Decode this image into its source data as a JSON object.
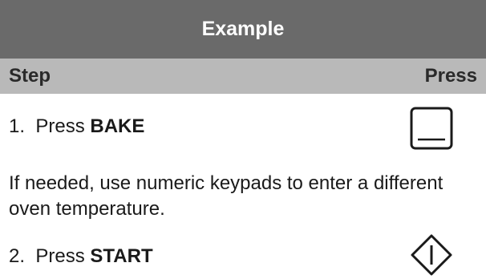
{
  "title": "Example",
  "header": {
    "step": "Step",
    "press": "Press"
  },
  "steps": [
    {
      "number": "1.",
      "prefix": "Press",
      "key": "BAKE",
      "icon": "bake-button-icon"
    },
    {
      "number": "2.",
      "prefix": "Press",
      "key": "START",
      "icon": "start-button-icon"
    }
  ],
  "note": "If needed, use numeric keypads to enter a different oven temperature.",
  "colors": {
    "title_bar": "#6a6a6a",
    "header_bar": "#b9b9b9",
    "text": "#1a1a1a"
  }
}
